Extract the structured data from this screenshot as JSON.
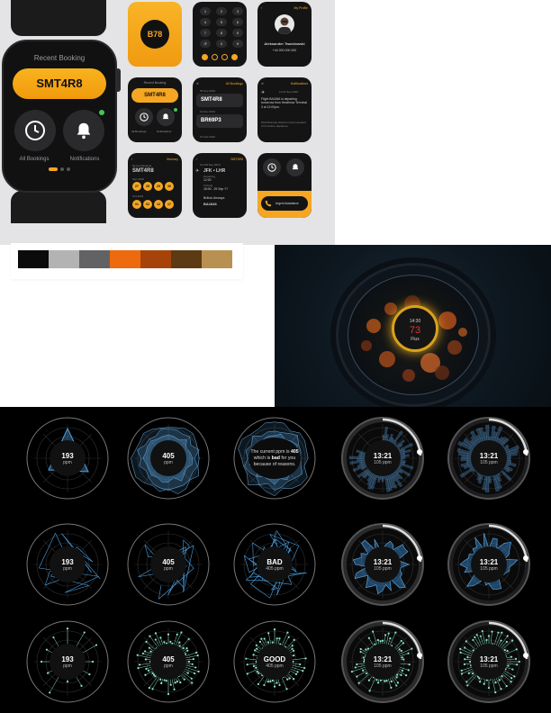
{
  "colors": {
    "accent_orange": "#f5a623",
    "dark": "#141415",
    "panel_bg": "#e4e4e6",
    "blue_glow": "#3a8fd8",
    "teal": "#7ee0c0",
    "red_readout": "#e3342f"
  },
  "palette_colors": [
    "#0b0b0b",
    "#b3b3b3",
    "#626264",
    "#ee6a0e",
    "#a6430a",
    "#5c3a13",
    "#b89152"
  ],
  "big_watch": {
    "title": "Recent Booking",
    "booking_code": "SMT4R8",
    "left_button_label": "All Bookings",
    "right_button_label": "Notifications",
    "left_icon": "clock-icon",
    "right_icon": "bell-icon"
  },
  "tiles": {
    "logo": {
      "text": "B78"
    },
    "keypad": {
      "keys": [
        "1",
        "2",
        "3",
        "4",
        "5",
        "6",
        "7",
        "8",
        "9",
        "↺",
        "0",
        "✕"
      ]
    },
    "profile": {
      "header": "My Profile",
      "name": "Aleksander Twardowski",
      "line": "+44 000 000 000"
    },
    "recent": {
      "header": "Recent Booking",
      "code": "SMT4R8",
      "left_label": "All Bookings",
      "right_label": "Notifications"
    },
    "all_bookings": {
      "header": "All Bookings",
      "items": [
        {
          "date": "05 Sep 2019",
          "code": "SMT4R8"
        },
        {
          "date": "12 Nov 2019",
          "code": "BR69P3"
        },
        {
          "date": "07 Feb 2019",
          "code": ""
        }
      ]
    },
    "notifications": {
      "header": "Notifications",
      "date": "11:21 Sep 2019",
      "message": "Flight BA1846 is departing tomorrow from Heathrow Terminal 3 at 12:00pm.",
      "message2": "Wi-Fi/Internet check is recommended 2 hrs before departure"
    },
    "itinerary": {
      "header": "Itinerary",
      "subtitle": "Recent Booking",
      "code": "SMT4R8",
      "group1_label": "Sep 2019",
      "group1_dates": [
        "27",
        "28",
        "29",
        "30"
      ],
      "group2_label": "Oct 2019",
      "group2_dates": [
        "01",
        "02",
        "12",
        "17"
      ]
    },
    "flight": {
      "header": "SMT4R8",
      "date": "Oct 08 Sep 2019",
      "route": "JFK • LHR",
      "departing_label": "Departing",
      "departing_time": "12:00",
      "arriving_label": "Arriving",
      "arriving_time": "18:00 - 29 Sep ??",
      "airline": "British Airways",
      "flight_no": "BA1846"
    },
    "support": {
      "label": "Urgent Assistance"
    }
  },
  "glow_watch": {
    "time": "14:30",
    "value": "73",
    "label": "Flux"
  },
  "dials": [
    {
      "main": "193",
      "sub": "ppm"
    },
    {
      "main": "405",
      "sub": "ppm"
    },
    {
      "message_pre": "The current ppm is ",
      "message_bold1": "405",
      "message_mid": " which is ",
      "message_bold2": "bad",
      "message_post": " for you because of reasons."
    },
    {
      "main": "13:21",
      "sub": "105 ppm"
    },
    {
      "main": "13:21",
      "sub": "105 ppm"
    },
    {
      "main": "193",
      "sub": "ppm"
    },
    {
      "main": "405",
      "sub": "ppm"
    },
    {
      "main": "BAD",
      "sub": "405 ppm"
    },
    {
      "main": "13:21",
      "sub": "105 ppm"
    },
    {
      "main": "13:21",
      "sub": "105 ppm"
    },
    {
      "main": "193",
      "sub": "ppm"
    },
    {
      "main": "405",
      "sub": "ppm"
    },
    {
      "main": "GOOD",
      "sub": "405 ppm"
    },
    {
      "main": "13:21",
      "sub": "105 ppm"
    },
    {
      "main": "13:21",
      "sub": "105 ppm"
    }
  ]
}
